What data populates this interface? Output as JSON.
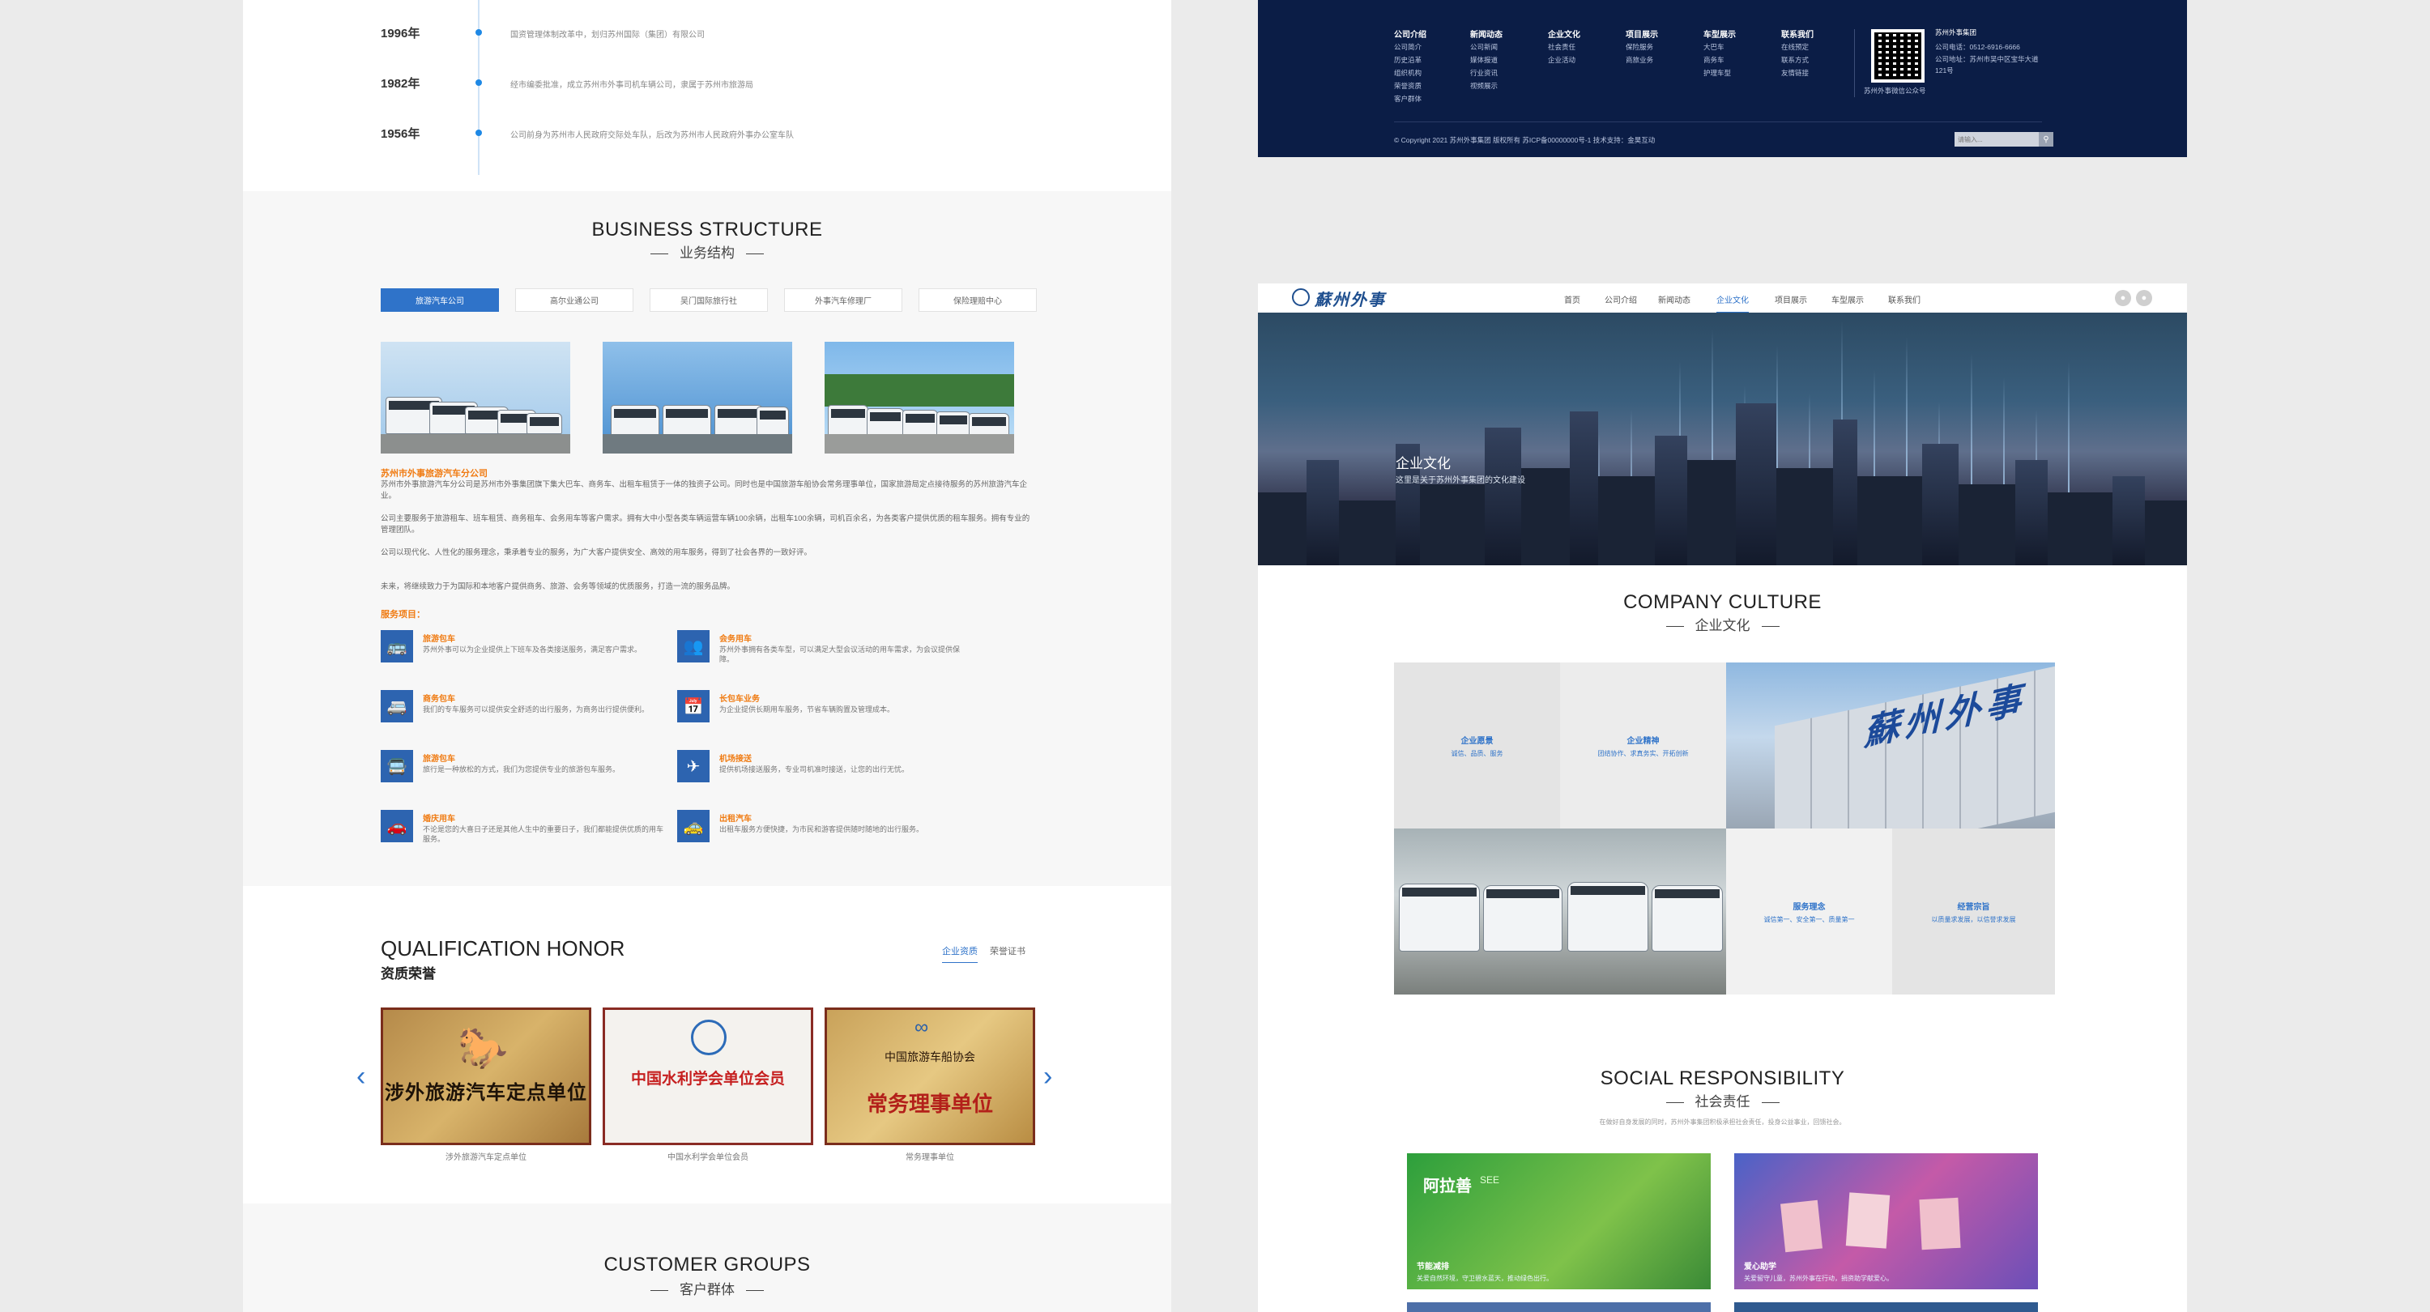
{
  "timeline": [
    {
      "year": "1996年",
      "text": "国资管理体制改革中，划归苏州国际（集团）有限公司"
    },
    {
      "year": "1982年",
      "text": "经市编委批准，成立苏州市外事司机车辆公司，隶属于苏州市旅游局"
    },
    {
      "year": "1956年",
      "text": "公司前身为苏州市人民政府交际处车队，后改为苏州市人民政府外事办公室车队"
    }
  ],
  "business": {
    "title_en": "BUSINESS STRUCTURE",
    "title_cn": "业务结构",
    "tabs": [
      "旅游汽车公司",
      "高尔业通公司",
      "吴门国际旅行社",
      "外事汽车修理厂",
      "保险理赔中心"
    ],
    "company_name": "苏州市外事旅游汽车分公司",
    "paragraphs": [
      "苏州市外事旅游汽车分公司是苏州市外事集团旗下集大巴车、商务车、出租车租赁于一体的独资子公司。同时也是中国旅游车船协会常务理事单位，国家旅游局定点接待服务的苏州旅游汽车企业。",
      "公司主要服务于旅游租车、班车租赁、商务租车、会务用车等客户需求。拥有大中小型各类车辆运营车辆100余辆，出租车100余辆，司机百余名，为各类客户提供优质的租车服务。拥有专业的管理团队。",
      "公司以现代化、人性化的服务理念，秉承着专业的服务，为广大客户提供安全、高效的用车服务，得到了社会各界的一致好评。",
      "未来，将继续致力于为国际和本地客户提供商务、旅游、会务等领域的优质服务，打造一流的服务品牌。"
    ],
    "service_heading": "服务项目：",
    "services": [
      {
        "icon": "bus-icon",
        "title": "旅游包车",
        "text": "苏州外事可以为企业提供上下班车及各类接送服务，满足客户需求。"
      },
      {
        "icon": "group-icon",
        "title": "会务用车",
        "text": "苏州外事拥有各类车型，可以满足大型会议活动的用车需求，为会议提供保障。"
      },
      {
        "icon": "shuttle-icon",
        "title": "商务包车",
        "text": "我们的专车服务可以提供安全舒适的出行服务，为商务出行提供便利。"
      },
      {
        "icon": "calendar-icon",
        "title": "长包车业务",
        "text": "为企业提供长期用车服务，节省车辆购置及管理成本。"
      },
      {
        "icon": "coach-icon",
        "title": "旅游包车",
        "text": "旅行是一种放松的方式，我们为您提供专业的旅游包车服务。"
      },
      {
        "icon": "plane-icon",
        "title": "机场接送",
        "text": "提供机场接送服务，专业司机准时接送，让您的出行无忧。"
      },
      {
        "icon": "car-icon",
        "title": "婚庆用车",
        "text": "不论是您的大喜日子还是其他人生中的重要日子，我们都能提供优质的用车服务。"
      },
      {
        "icon": "taxi-icon",
        "title": "出租汽车",
        "text": "出租车服务方便快捷，为市民和游客提供随时随地的出行服务。"
      }
    ]
  },
  "qualification": {
    "title_en": "QUALIFICATION HONOR",
    "title_cn": "资质荣誉",
    "tabs": [
      "企业资质",
      "荣誉证书"
    ],
    "plaques": [
      {
        "text": "涉外旅游汽车定点单位",
        "caption": "涉外旅游汽车定点单位"
      },
      {
        "text": "中国水利学会单位会员",
        "caption": "中国水利学会单位会员"
      },
      {
        "org": "中国旅游车船协会",
        "text": "常务理事单位",
        "caption": "常务理事单位"
      }
    ]
  },
  "customers": {
    "title_en": "CUSTOMER GROUPS",
    "title_cn": "客户群体"
  },
  "footer": {
    "columns": [
      {
        "title": "公司介绍",
        "links": [
          "公司简介",
          "历史沿革",
          "组织机构",
          "荣誉资质",
          "客户群体"
        ]
      },
      {
        "title": "新闻动态",
        "links": [
          "公司新闻",
          "媒体报道",
          "行业资讯",
          "视频展示"
        ]
      },
      {
        "title": "企业文化",
        "links": [
          "社会责任",
          "企业活动"
        ]
      },
      {
        "title": "项目展示",
        "links": [
          "保险服务",
          "商旅业务"
        ]
      },
      {
        "title": "车型展示",
        "links": [
          "大巴车",
          "商务车",
          "护理车型"
        ]
      },
      {
        "title": "联系我们",
        "links": [
          "在线预定",
          "联系方式",
          "友情链接"
        ]
      }
    ],
    "qr_caption": "苏州外事微信公众号",
    "company": "苏州外事集团",
    "phone": "公司电话：0512-6916-6666",
    "address": "公司地址：苏州市吴中区宝华大道121号",
    "copyright": "© Copyright 2021 苏州外事集团 版权所有 苏ICP备00000000号-1 技术支持：金昊互动",
    "search_placeholder": "请输入..."
  },
  "main_nav": {
    "logo_text": "蘇州外事",
    "items": [
      "首页",
      "公司介绍",
      "新闻动态",
      "企业文化",
      "项目展示",
      "车型展示",
      "联系我们"
    ],
    "active": "企业文化"
  },
  "hero": {
    "title": "企业文化",
    "subtitle": "这里是关于苏州外事集团的文化建设"
  },
  "culture": {
    "title_en": "COMPANY CULTURE",
    "title_cn": "企业文化",
    "cells": [
      {
        "title": "企业愿景",
        "text": "诚信、品质、服务"
      },
      {
        "title": "企业精神",
        "text": "团结协作、求真务实、开拓创新"
      },
      {
        "title": "服务理念",
        "text": "诚信第一、安全第一、质量第一"
      },
      {
        "title": "经营宗旨",
        "text": "以质量求发展，以信誉求发展"
      }
    ],
    "building_sign": "蘇州外事"
  },
  "social": {
    "title_en": "SOCIAL RESPONSIBILITY",
    "title_cn": "社会责任",
    "intro": "在做好自身发展的同时，苏州外事集团积极承担社会责任，投身公益事业，回馈社会。",
    "tiles": [
      {
        "brand": "阿拉善",
        "brand_sub": "SEE",
        "caption": "节能减排",
        "text": "关爱自然环境，守卫碧水蓝天，推动绿色出行。"
      },
      {
        "caption": "爱心助学",
        "text": "关爱留守儿童，苏州外事在行动，捐资助学献爱心。"
      }
    ]
  },
  "colors": {
    "accent": "#2f73c9",
    "orange": "#f07b12",
    "footer_bg": "#0b1d46"
  }
}
